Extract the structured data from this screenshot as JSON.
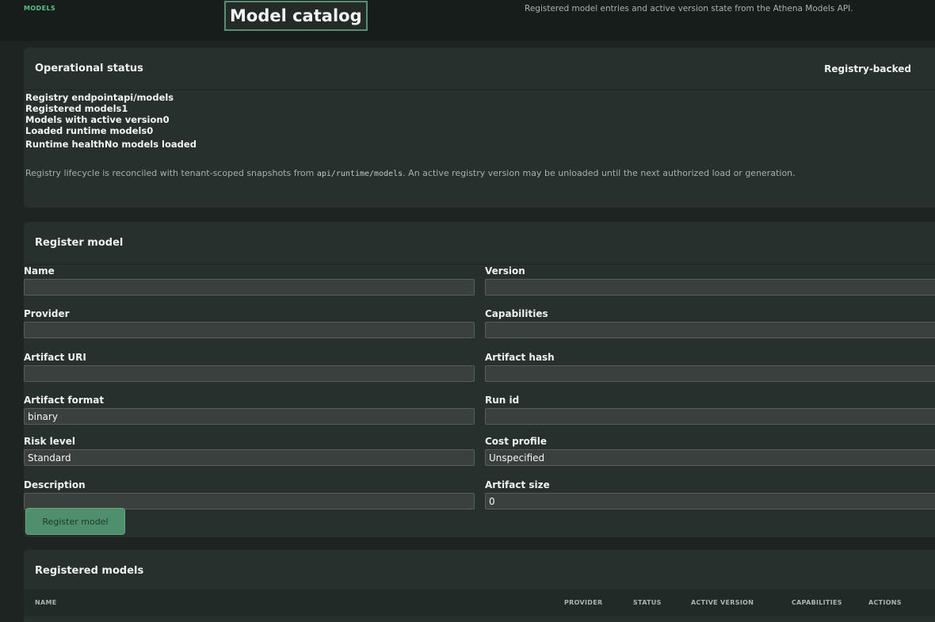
{
  "header": {
    "eyebrow": "MODELS",
    "title": "Model catalog",
    "subtitle": "Registered model entries and active version state from the Athena Models API."
  },
  "status": {
    "title": "Operational status",
    "badge": "Registry-backed",
    "rows": [
      "Registry endpointapi/models",
      "Registered models1",
      "Models with active version0",
      "Loaded runtime models0",
      "Runtime healthNo models loaded"
    ],
    "note_before": "Registry lifecycle is reconciled with tenant-scoped snapshots from ",
    "note_code": "api/runtime/models",
    "note_after": ". An active registry version may be unloaded until the next authorized load or generation."
  },
  "register": {
    "title": "Register model",
    "fields": {
      "name": {
        "label": "Name",
        "value": ""
      },
      "version": {
        "label": "Version",
        "value": ""
      },
      "provider": {
        "label": "Provider",
        "value": ""
      },
      "capabilities": {
        "label": "Capabilities",
        "value": ""
      },
      "artifact_uri": {
        "label": "Artifact URI",
        "value": ""
      },
      "artifact_hash": {
        "label": "Artifact hash",
        "value": ""
      },
      "artifact_format": {
        "label": "Artifact format",
        "value": "binary"
      },
      "run_id": {
        "label": "Run id",
        "value": ""
      },
      "risk_level": {
        "label": "Risk level",
        "value": "Standard"
      },
      "cost_profile": {
        "label": "Cost profile",
        "value": "Unspecified"
      },
      "description": {
        "label": "Description",
        "value": ""
      },
      "artifact_size": {
        "label": "Artifact size",
        "value": "0"
      }
    },
    "submit_label": "Register model"
  },
  "models": {
    "title": "Registered models",
    "columns": {
      "name": "NAME",
      "provider": "PROVIDER",
      "status": "STATUS",
      "active_version": "ACTIVE VERSION",
      "capabilities": "CAPABILITIES",
      "actions": "ACTIONS"
    }
  },
  "colors": {
    "background": "#1d2421",
    "panel": "#27302c",
    "accent": "#4f8f6d",
    "eyebrow": "#5bbd8c"
  }
}
